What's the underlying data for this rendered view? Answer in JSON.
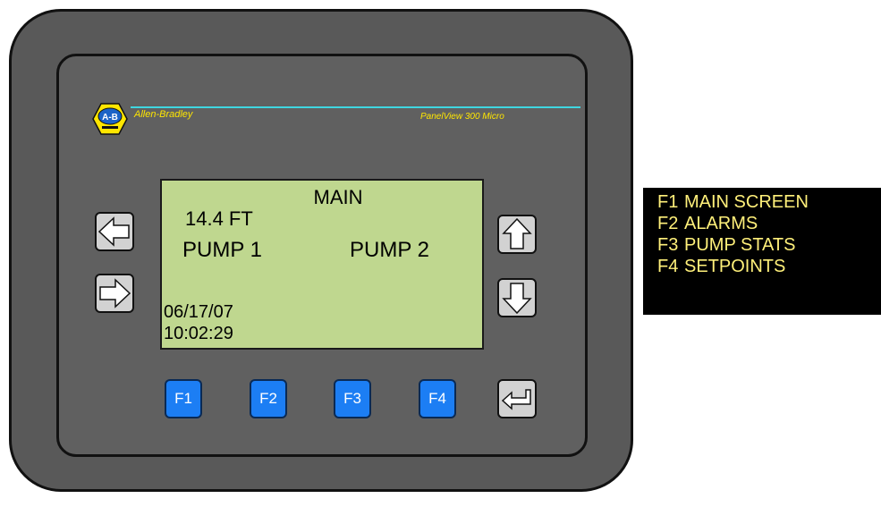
{
  "branding": {
    "logo_text": "A-B",
    "brand_name": "Allen-Bradley",
    "model_name": "PanelView 300 Micro"
  },
  "display": {
    "title": "MAIN",
    "level": "14.4  FT",
    "pump1": "PUMP 1",
    "pump2": "PUMP 2",
    "date": "06/17/07",
    "time": "10:02:29"
  },
  "keys": {
    "arrows": {
      "left": "left-arrow-icon",
      "right": "right-arrow-icon",
      "up": "up-arrow-icon",
      "down": "down-arrow-icon"
    },
    "function_keys": [
      "F1",
      "F2",
      "F3",
      "F4"
    ],
    "enter": "enter-icon"
  },
  "legend": {
    "items": [
      {
        "key": "F1",
        "label": "MAIN SCREEN"
      },
      {
        "key": "F2",
        "label": "ALARMS"
      },
      {
        "key": "F3",
        "label": "PUMP STATS"
      },
      {
        "key": "F4",
        "label": "SETPOINTS"
      }
    ]
  },
  "colors": {
    "housing": "#595959",
    "lcd_background": "#bfd78f",
    "function_key": "#1c7ef4",
    "brand_text": "#ffe600",
    "legend_text": "#fff07a",
    "legend_background": "#000000"
  }
}
